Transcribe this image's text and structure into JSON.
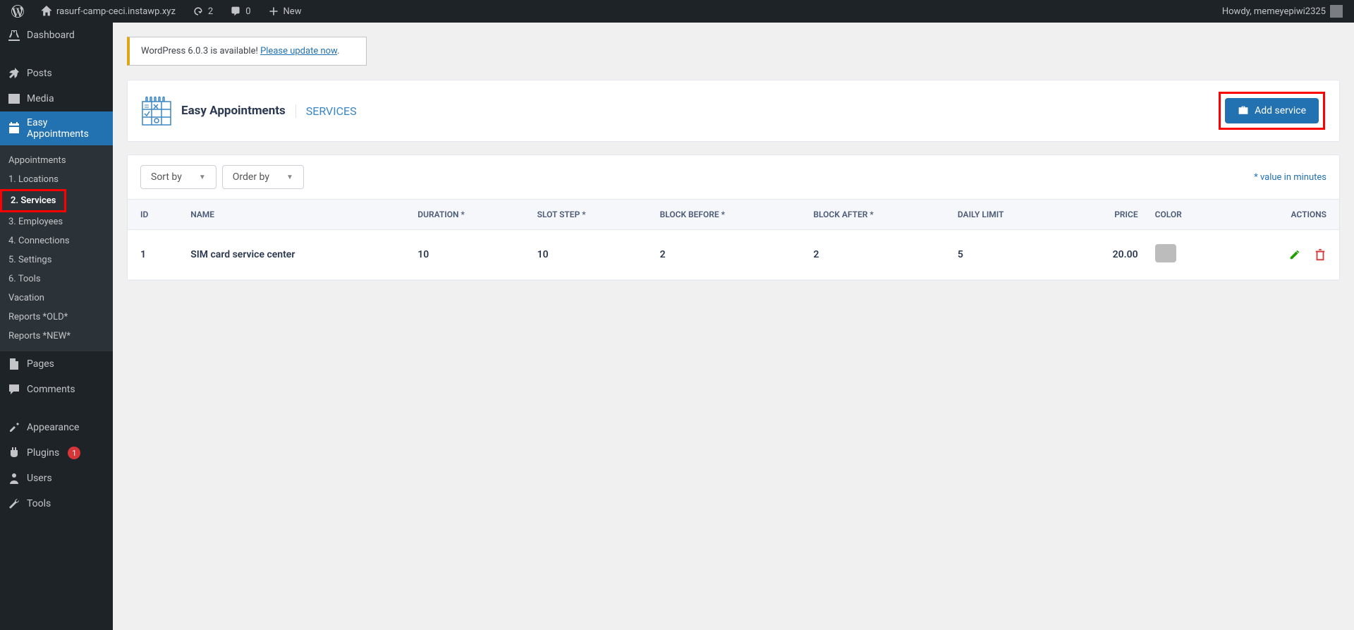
{
  "adminbar": {
    "site_name": "rasurf-camp-ceci.instawp.xyz",
    "updates": "2",
    "comments": "0",
    "new": "New",
    "howdy": "Howdy, memeyepiwi2325"
  },
  "sidebar": {
    "main": [
      {
        "label": "Dashboard",
        "icon": "dashboard"
      },
      {
        "label": "Posts",
        "icon": "pin"
      },
      {
        "label": "Media",
        "icon": "media"
      },
      {
        "label": "Easy Appointments",
        "icon": "calendar",
        "active": true
      },
      {
        "label": "Pages",
        "icon": "page"
      },
      {
        "label": "Comments",
        "icon": "comment"
      },
      {
        "label": "Appearance",
        "icon": "brush"
      },
      {
        "label": "Plugins",
        "icon": "plug",
        "count": "1"
      },
      {
        "label": "Users",
        "icon": "user"
      },
      {
        "label": "Tools",
        "icon": "wrench"
      }
    ],
    "submenu": [
      {
        "label": "Appointments"
      },
      {
        "label": "1. Locations"
      },
      {
        "label": "2. Services",
        "active": true,
        "highlight": true
      },
      {
        "label": "3. Employees"
      },
      {
        "label": "4. Connections"
      },
      {
        "label": "5. Settings"
      },
      {
        "label": "6. Tools"
      },
      {
        "label": "Vacation"
      },
      {
        "label": "Reports *OLD*"
      },
      {
        "label": "Reports *NEW*"
      }
    ]
  },
  "notice": {
    "text_before": "WordPress 6.0.3 is available! ",
    "link": "Please update now"
  },
  "header": {
    "plugin": "Easy Appointments",
    "section": "SERVICES",
    "add_button": "Add service"
  },
  "toolbar": {
    "sort_by": "Sort by",
    "order_by": "Order by",
    "note": "* value in minutes"
  },
  "table": {
    "headers": {
      "id": "ID",
      "name": "NAME",
      "duration": "DURATION *",
      "slot": "SLOT STEP *",
      "before": "BLOCK BEFORE *",
      "after": "BLOCK AFTER *",
      "limit": "DAILY LIMIT",
      "price": "PRICE",
      "color": "COLOR",
      "actions": "ACTIONS"
    },
    "rows": [
      {
        "id": "1",
        "name": "SIM card service center",
        "duration": "10",
        "slot": "10",
        "before": "2",
        "after": "2",
        "limit": "5",
        "price": "20.00"
      }
    ]
  }
}
